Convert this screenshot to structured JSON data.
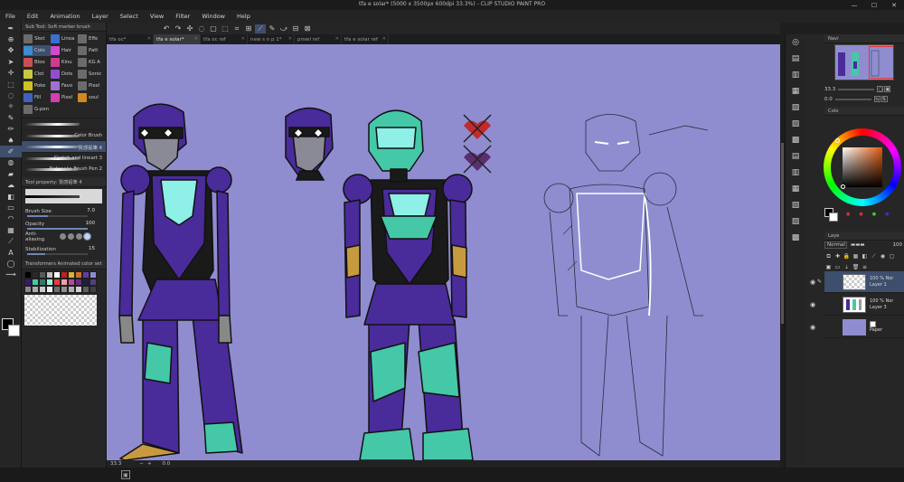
{
  "window": {
    "title": "tfa e solar* (5000 x 3500px 600dpi 33.3%) - CLIP STUDIO PAINT PRO",
    "minimize": "—",
    "maximize": "☐",
    "close": "✕"
  },
  "menu": [
    "File",
    "Edit",
    "Animation",
    "Layer",
    "Select",
    "View",
    "Filter",
    "Window",
    "Help"
  ],
  "doc_tabs": [
    {
      "label": "tfa oc*",
      "active": false
    },
    {
      "label": "tfa e solar*",
      "active": true
    },
    {
      "label": "tfa oc ref",
      "active": false
    },
    {
      "label": "new s n p 1*",
      "active": false
    },
    {
      "label": "prowl ref",
      "active": false
    },
    {
      "label": "tfa e solar ref",
      "active": false
    }
  ],
  "sub_tool_panel": {
    "header": "Sub Tool: Soft marker brush",
    "groups": [
      {
        "label": "Sket",
        "color": "#6b6b6b",
        "active": false
      },
      {
        "label": "Linea",
        "color": "#3a6fd0",
        "active": false
      },
      {
        "label": "Effe",
        "color": "#6b6b6b",
        "active": false
      },
      {
        "label": "Colo",
        "color": "#3d8bd0",
        "active": true
      },
      {
        "label": "Hair",
        "color": "#d04ad0",
        "active": false
      },
      {
        "label": "Patt",
        "color": "#6b6b6b",
        "active": false
      },
      {
        "label": "Bloo",
        "color": "#c95050",
        "active": false
      },
      {
        "label": "Kinu",
        "color": "#d03a90",
        "active": false
      },
      {
        "label": "KG A",
        "color": "#6b6b6b",
        "active": false
      },
      {
        "label": "Clot",
        "color": "#c8c840",
        "active": false
      },
      {
        "label": "Dots",
        "color": "#8f4fd0",
        "active": false
      },
      {
        "label": "Sonic",
        "color": "#6b6b6b",
        "active": false
      },
      {
        "label": "Poke",
        "color": "#d0c020",
        "active": false
      },
      {
        "label": "Favo",
        "color": "#a070d0",
        "active": false
      },
      {
        "label": "Pixel",
        "color": "#6b6b6b",
        "active": false
      },
      {
        "label": "Fill",
        "color": "#4060c0",
        "active": false
      },
      {
        "label": "Pixel",
        "color": "#d040b0",
        "active": false
      },
      {
        "label": "soul",
        "color": "#d08a20",
        "active": false
      },
      {
        "label": "G-pen",
        "color": "#6b6b6b",
        "active": false
      }
    ],
    "brushes": [
      {
        "label": "",
        "active": false
      },
      {
        "label": "Color Brush",
        "active": false
      },
      {
        "label": "質感鉛筆 4",
        "active": true
      },
      {
        "label": "Sketch and lineart 3",
        "active": false
      },
      {
        "label": "Nebraska Brush Pen 2",
        "active": false
      }
    ]
  },
  "tool_property": {
    "header": "Tool property: 質感鉛筆 4",
    "brush_size": {
      "label": "Brush Size",
      "value": "7.0",
      "level": 0.35
    },
    "opacity": {
      "label": "Opacity",
      "value": "100",
      "level": 1.0
    },
    "antialiasing": {
      "label": "Anti-aliasing"
    },
    "stabilization": {
      "label": "Stabilization",
      "value": "15",
      "level": 0.3
    }
  },
  "color_set": {
    "header": "Transformers Animated color set",
    "swatches": [
      "#000000",
      "#2a2a2a",
      "#5a5a5a",
      "#c0c0c0",
      "#ffffff",
      "#c02020",
      "#e0b030",
      "#d06f2a",
      "#5e3fa0",
      "#8f8dd0",
      "#3a1a70",
      "#45c8a8",
      "#2a7f6a",
      "#a0f0e0",
      "#e04040",
      "#f0a0a0",
      "#b04aa0",
      "#6a2a80",
      "#202040",
      "#504080",
      "#888888",
      "#aaaaaa",
      "#cccccc",
      "#eeeeee",
      "#707070",
      "#909090",
      "#b0b0b0",
      "#d0d0d0",
      "#606060",
      "#404040"
    ]
  },
  "right_panel": {
    "navigator_label": "Navi",
    "zoom": "33.3",
    "rotation": "0.0",
    "color_wheel_label": "Colo",
    "layer_label": "Laye",
    "blend_mode": "Normal",
    "opacity": "100",
    "layers": [
      {
        "opacity": "100 % Nor",
        "name": "Layer 1",
        "active": true,
        "thumb": "checker"
      },
      {
        "opacity": "100 % Nor",
        "name": "Layer 3",
        "active": false,
        "thumb": "figure"
      },
      {
        "opacity": "",
        "name": "Paper",
        "active": false,
        "thumb": "paper"
      }
    ]
  },
  "status": {
    "zoom": "33.3",
    "rotation": "0.0"
  },
  "colors": {
    "canvas": "#8f8dd0",
    "armor_purple": "#4a2b9a",
    "armor_teal": "#45c8a8",
    "visor": "#8ef0e6",
    "accent": "#3d4f6d"
  }
}
